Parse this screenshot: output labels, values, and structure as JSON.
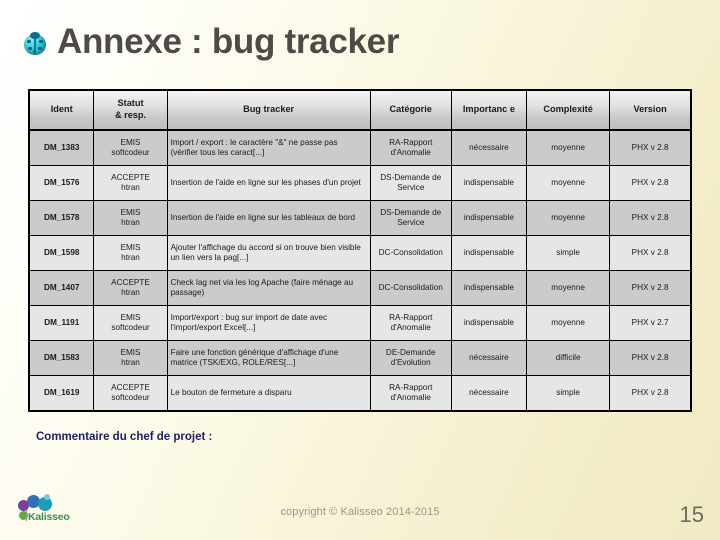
{
  "slide": {
    "title": "Annexe : bug tracker",
    "title_icon": "ladybug-icon",
    "accent_color": "#4f4a47",
    "background_color": "#f2ecc8"
  },
  "table": {
    "headers": [
      "Ident",
      "Statut\n& resp.",
      "Bug tracker",
      "Catégorie",
      "Importance",
      "Complexité",
      "Version"
    ],
    "header_ident": "Ident",
    "header_statut_line1": "Statut",
    "header_statut_line2": "& resp.",
    "header_bug_tracker": "Bug tracker",
    "header_categorie": "Catégorie",
    "header_importance": "Importanc e",
    "header_complexite": "Complexité",
    "header_version": "Version",
    "rows": [
      {
        "ident": "DM_1383",
        "statut": "EMIS",
        "resp": "softcodeur",
        "description": "Import / export : le caractère \"&\" ne passe pas (vérifier tous les caract[...]",
        "categorie": "RA-Rapport d'Anomalie",
        "importance": "nécessaire",
        "complexite": "moyenne",
        "version": "PHX v 2.8"
      },
      {
        "ident": "DM_1576",
        "statut": "ACCEPTE",
        "resp": "htran",
        "description": "Insertion de l'aide en ligne sur les phases d'un projet",
        "categorie": "DS-Demande de Service",
        "importance": "indispensable",
        "complexite": "moyenne",
        "version": "PHX v 2.8"
      },
      {
        "ident": "DM_1578",
        "statut": "EMIS",
        "resp": "htran",
        "description": "Insertion de l'aide en ligne sur les tableaux de bord",
        "categorie": "DS-Demande de Service",
        "importance": "indispensable",
        "complexite": "moyenne",
        "version": "PHX v 2.8"
      },
      {
        "ident": "DM_1598",
        "statut": "EMIS",
        "resp": "htran",
        "description": "Ajouter l'affichage du accord si on trouve bien visible un lien vers la pag[...]",
        "categorie": "DC-Consolidation",
        "importance": "indispensable",
        "complexite": "simple",
        "version": "PHX v 2.8"
      },
      {
        "ident": "DM_1407",
        "statut": "ACCEPTE",
        "resp": "htran",
        "description": "Check lag net via les log Apache (faire ménage au passage)",
        "categorie": "DC-Consolidation",
        "importance": "indispensable",
        "complexite": "moyenne",
        "version": "PHX v 2.8"
      },
      {
        "ident": "DM_1191",
        "statut": "EMIS",
        "resp": "softcodeur",
        "description": "Import/export : bug sur import de date avec l'import/export Excel[...]",
        "categorie": "RA-Rapport d'Anomalie",
        "importance": "indispensable",
        "complexite": "moyenne",
        "version": "PHX v 2.7"
      },
      {
        "ident": "DM_1583",
        "statut": "EMIS",
        "resp": "htran",
        "description": "Faire une fonction générique d'affichage d'une matrice (TSK/EXG, ROLE/RES[...]",
        "categorie": "DE-Demande d'Evolution",
        "importance": "nécessaire",
        "complexite": "difficile",
        "version": "PHX v 2.8"
      },
      {
        "ident": "DM_1619",
        "statut": "ACCEPTE",
        "resp": "softcodeur",
        "description": "Le bouton de fermeture a disparu",
        "categorie": "RA-Rapport d'Anomalie",
        "importance": "nécessaire",
        "complexite": "simple",
        "version": "PHX v 2.8"
      }
    ]
  },
  "comment": {
    "label": "Commentaire du chef de projet :",
    "color": "#1f1f63"
  },
  "footer": {
    "copyright": "copyright © Kalisseo 2014-2015",
    "page_number": "15",
    "logo_text": "Kalisseo"
  }
}
